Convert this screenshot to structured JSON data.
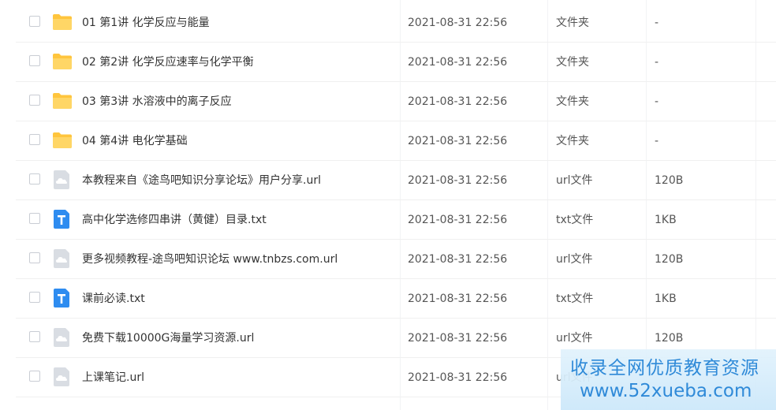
{
  "files": [
    {
      "name": "01 第1讲 化学反应与能量",
      "date": "2021-08-31 22:56",
      "type": "文件夹",
      "size": "-",
      "icon": "folder-icon"
    },
    {
      "name": "02 第2讲 化学反应速率与化学平衡",
      "date": "2021-08-31 22:56",
      "type": "文件夹",
      "size": "-",
      "icon": "folder-icon"
    },
    {
      "name": "03 第3讲 水溶液中的离子反应",
      "date": "2021-08-31 22:56",
      "type": "文件夹",
      "size": "-",
      "icon": "folder-icon"
    },
    {
      "name": "04 第4讲 电化学基础",
      "date": "2021-08-31 22:56",
      "type": "文件夹",
      "size": "-",
      "icon": "folder-icon"
    },
    {
      "name": "本教程来自《途鸟吧知识分享论坛》用户分享.url",
      "date": "2021-08-31 22:56",
      "type": "url文件",
      "size": "120B",
      "icon": "url-file-icon"
    },
    {
      "name": "高中化学选修四串讲（黄健）目录.txt",
      "date": "2021-08-31 22:56",
      "type": "txt文件",
      "size": "1KB",
      "icon": "txt-file-icon"
    },
    {
      "name": "更多视频教程-途鸟吧知识论坛 www.tnbzs.com.url",
      "date": "2021-08-31 22:56",
      "type": "url文件",
      "size": "120B",
      "icon": "url-file-icon"
    },
    {
      "name": "课前必读.txt",
      "date": "2021-08-31 22:56",
      "type": "txt文件",
      "size": "1KB",
      "icon": "txt-file-icon"
    },
    {
      "name": "免费下载10000G海量学习资源.url",
      "date": "2021-08-31 22:56",
      "type": "url文件",
      "size": "120B",
      "icon": "url-file-icon"
    },
    {
      "name": "上课笔记.url",
      "date": "2021-08-31 22:56",
      "type": "url文件",
      "size": "",
      "icon": "url-file-icon"
    }
  ],
  "watermark": {
    "line1": "收录全网优质教育资源",
    "line2": "www.52xueba.com"
  },
  "colors": {
    "folder": "#ffc53d",
    "txt_icon": "#2e8cf0",
    "url_icon": "#d9dde3",
    "watermark_text": "#2f8ad8"
  }
}
